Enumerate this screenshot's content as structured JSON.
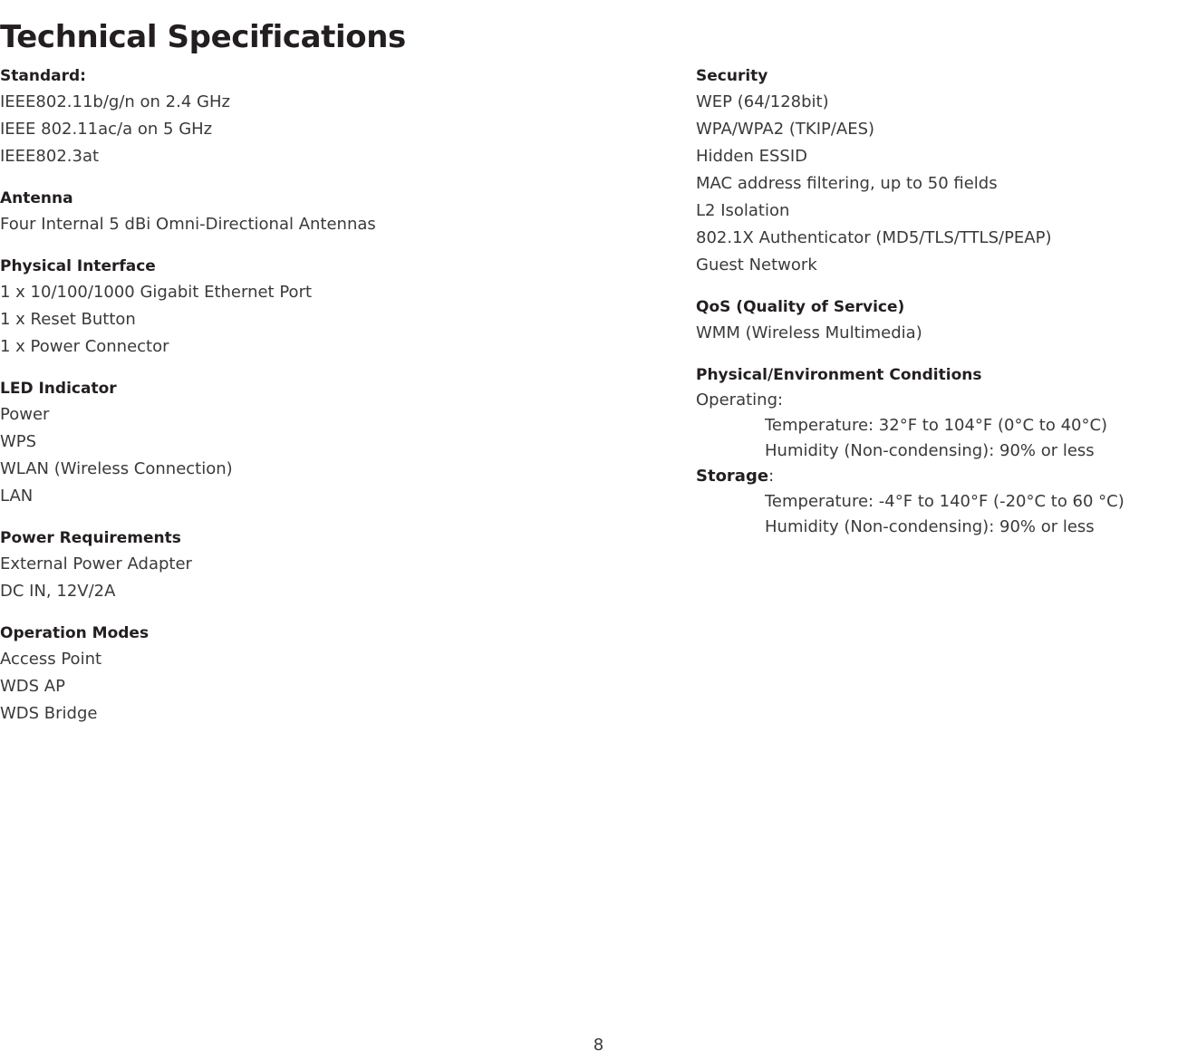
{
  "page": {
    "title": "Technical Specifications",
    "number": "8"
  },
  "left_column": [
    {
      "heading": "Standard:",
      "lines": [
        "IEEE802.11b/g/n on 2.4 GHz",
        "IEEE 802.11ac/a on 5 GHz",
        "IEEE802.3at"
      ]
    },
    {
      "heading": "Antenna",
      "lines": [
        "Four Internal 5 dBi Omni-Directional Antennas"
      ]
    },
    {
      "heading": "Physical Interface",
      "lines": [
        "1 x 10/100/1000 Gigabit Ethernet Port",
        "1 x Reset Button",
        "1 x Power Connector"
      ]
    },
    {
      "heading": "LED Indicator",
      "lines": [
        "Power",
        "WPS",
        "WLAN (Wireless Connection)",
        "LAN"
      ]
    },
    {
      "heading": "Power Requirements",
      "lines": [
        "External Power Adapter",
        "DC IN, 12V/2A"
      ]
    },
    {
      "heading": "Operation Modes",
      "lines": [
        "Access Point",
        "WDS AP",
        "WDS Bridge"
      ]
    }
  ],
  "right_column": {
    "security": {
      "heading": "Security",
      "lines": [
        "WEP (64/128bit)",
        "WPA/WPA2 (TKIP/AES)",
        "Hidden ESSID",
        "MAC address filtering, up to 50 fields",
        "L2 Isolation",
        "802.1X Authenticator (MD5/TLS/TTLS/PEAP)",
        "Guest Network"
      ]
    },
    "qos": {
      "heading": "QoS (Quality of Service)",
      "lines": [
        "WMM (Wireless Multimedia)"
      ]
    },
    "environment": {
      "heading": "Physical/Environment Conditions",
      "operating_label": "Operating:",
      "operating_lines": [
        "Temperature: 32°F to 104°F (0°C to 40°C)",
        "Humidity (Non-condensing): 90% or less"
      ],
      "storage_label_bold": "Storage",
      "storage_label_rest": ":",
      "storage_lines": [
        "Temperature: -4°F to 140°F (-20°C to 60 °C)",
        "Humidity (Non-condensing): 90% or less"
      ]
    }
  }
}
